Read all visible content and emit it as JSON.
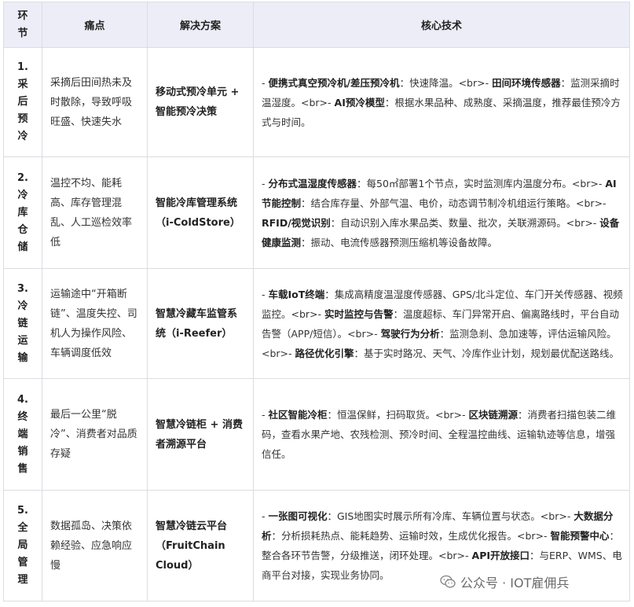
{
  "headers": [
    "环节",
    "痛点",
    "解决方案",
    "核心技术"
  ],
  "rows": [
    {
      "stage_num": "1.",
      "stage_chars": [
        "采",
        "后",
        "预",
        "冷"
      ],
      "pain": "采摘后田间热未及时散除，导致呼吸旺盛、快速失水",
      "solution": "移动式预冷单元 + 智能预冷决策",
      "tech": [
        {
          "prefix": "- ",
          "bold": "便携式真空预冷机/差压预冷机",
          "text": "：快速降温。<br>- "
        },
        {
          "prefix": "",
          "bold": "田间环境传感器",
          "text": "：监测采摘时温湿度。<br>- "
        },
        {
          "prefix": "",
          "bold": "AI预冷模型",
          "text": "：根据水果品种、成熟度、采摘温度，推荐最佳预冷方式与时间。"
        }
      ]
    },
    {
      "stage_num": "2.",
      "stage_chars": [
        "冷",
        "库",
        "仓",
        "储"
      ],
      "pain": "温控不均、能耗高、库存管理混乱、人工巡检效率低",
      "solution": "智能冷库管理系统（i-ColdStore）",
      "tech": [
        {
          "prefix": "- ",
          "bold": "分布式温湿度传感器",
          "text": "：每50㎡部署1个节点，实时监测库内温度分布。<br>- "
        },
        {
          "prefix": "",
          "bold": "AI节能控制",
          "text": "：结合库存量、外部气温、电价，动态调节制冷机组运行策略。<br>- "
        },
        {
          "prefix": "",
          "bold": "RFID/视觉识别",
          "text": "：自动识别入库水果品类、数量、批次，关联溯源码。<br>- "
        },
        {
          "prefix": "",
          "bold": "设备健康监测",
          "text": "：振动、电流传感器预测压缩机等设备故障。"
        }
      ]
    },
    {
      "stage_num": "3.",
      "stage_chars": [
        "冷",
        "链",
        "运",
        "输"
      ],
      "pain": "运输途中“开箱断链”、温度失控、司机人为操作风险、车辆调度低效",
      "solution": "智慧冷藏车监管系统（i-Reefer）",
      "tech": [
        {
          "prefix": "- ",
          "bold": "车载IoT终端",
          "text": "：集成高精度温湿度传感器、GPS/北斗定位、车门开关传感器、视频监控。<br>- "
        },
        {
          "prefix": "",
          "bold": "实时监控与告警",
          "text": "：温度超标、车门异常开启、偏离路线时，平台自动告警（APP/短信）。<br>- "
        },
        {
          "prefix": "",
          "bold": "驾驶行为分析",
          "text": "：监测急刹、急加速等，评估运输风险。<br>- "
        },
        {
          "prefix": "",
          "bold": "路径优化引擎",
          "text": "：基于实时路况、天气、冷库作业计划，规划最优配送路线。"
        }
      ]
    },
    {
      "stage_num": "4.",
      "stage_chars": [
        "终",
        "端",
        "销",
        "售"
      ],
      "pain": "最后一公里“脱冷”、消费者对品质存疑",
      "solution": "智慧冷链柜 + 消费者溯源平台",
      "tech": [
        {
          "prefix": "- ",
          "bold": "社区智能冷柜",
          "text": "：恒温保鲜，扫码取货。<br>- "
        },
        {
          "prefix": "",
          "bold": "区块链溯源",
          "text": "：消费者扫描包装二维码，查看水果产地、农残检测、预冷时间、全程温控曲线、运输轨迹等信息，增强信任。"
        }
      ]
    },
    {
      "stage_num": "5.",
      "stage_chars": [
        "全",
        "局",
        "管",
        "理"
      ],
      "pain": "数据孤岛、决策依赖经验、应急响应慢",
      "solution": "智慧冷链云平台（FruitChain Cloud）",
      "tech": [
        {
          "prefix": "- ",
          "bold": "一张图可视化",
          "text": "：GIS地图实时展示所有冷库、车辆位置与状态。<br>- "
        },
        {
          "prefix": "",
          "bold": "大数据分析",
          "text": "：分析损耗热点、能耗趋势、运输时效，生成优化报告。<br>- "
        },
        {
          "prefix": "",
          "bold": "智能预警中心",
          "text": "：整合各环节告警，分级推送，闭环处理。<br>- "
        },
        {
          "prefix": "",
          "bold": "API开放接口",
          "text": "：与ERP、WMS、电商平台对接，实现业务协同。"
        }
      ]
    }
  ],
  "watermark": {
    "icon": "wechat-icon",
    "text": "公众号 · IOT雇佣兵"
  }
}
